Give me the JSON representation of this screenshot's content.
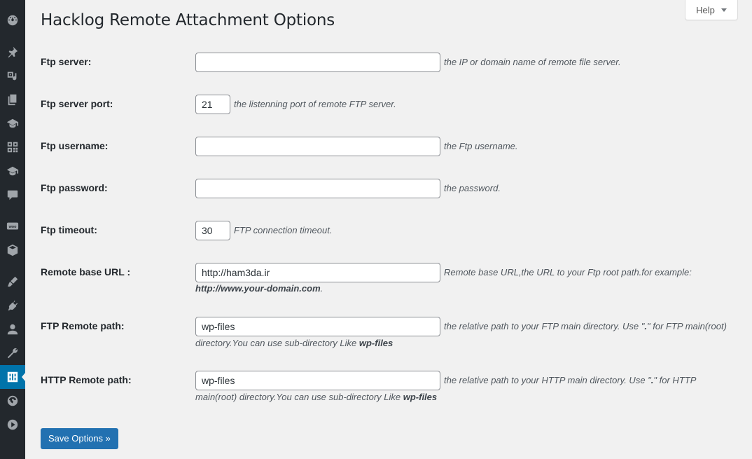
{
  "sidebar": {
    "icons": [
      "dashboard-icon",
      "pin-icon",
      "media-icon",
      "pages-icon",
      "education-icon",
      "grid-icon",
      "education-icon-2",
      "comments-icon",
      "woo-icon",
      "products-icon",
      "appearance-icon",
      "plugins-icon",
      "users-icon",
      "tools-icon",
      "settings-icon",
      "globe-icon",
      "play-icon"
    ],
    "active_index": 14,
    "woo_label": "woo"
  },
  "help": {
    "label": "Help"
  },
  "page_title": "Hacklog Remote Attachment Options",
  "fields": {
    "ftp_server": {
      "label": "Ftp server:",
      "value": "",
      "desc": "the IP or domain name of remote file server."
    },
    "ftp_port": {
      "label": "Ftp server port:",
      "value": "21",
      "desc": "the listenning port of remote FTP server."
    },
    "ftp_username": {
      "label": "Ftp username:",
      "value": "",
      "desc": "the Ftp username."
    },
    "ftp_password": {
      "label": "Ftp password:",
      "value": "",
      "desc": "the password."
    },
    "ftp_timeout": {
      "label": "Ftp timeout:",
      "value": "30",
      "desc": "FTP connection timeout."
    },
    "remote_url": {
      "label": "Remote base URL :",
      "value": "http://ham3da.ir",
      "desc": "Remote base URL,the URL to your Ftp root path.for example:",
      "desc_bold": "http://www.your-domain.com",
      "desc_end": "."
    },
    "ftp_remote_path": {
      "label": "FTP Remote path:",
      "value": "wp-files",
      "desc_a": "the relative path to your FTP main directory. Use \"",
      "desc_dot": ".",
      "desc_b": "\" for FTP main(root)",
      "desc_c": "directory.You can use sub-directory Like ",
      "desc_bold": "wp-files"
    },
    "http_remote_path": {
      "label": "HTTP Remote path:",
      "value": "wp-files",
      "desc_a": "the relative path to your HTTP main directory. Use \"",
      "desc_dot": ".",
      "desc_b": "\" for HTTP",
      "desc_c": "main(root) directory.You can use sub-directory Like ",
      "desc_bold": "wp-files"
    }
  },
  "save_button": {
    "label": "Save Options »"
  },
  "colors": {
    "sidebar_bg": "#23282d",
    "active": "#0073aa",
    "button": "#2271b1"
  }
}
